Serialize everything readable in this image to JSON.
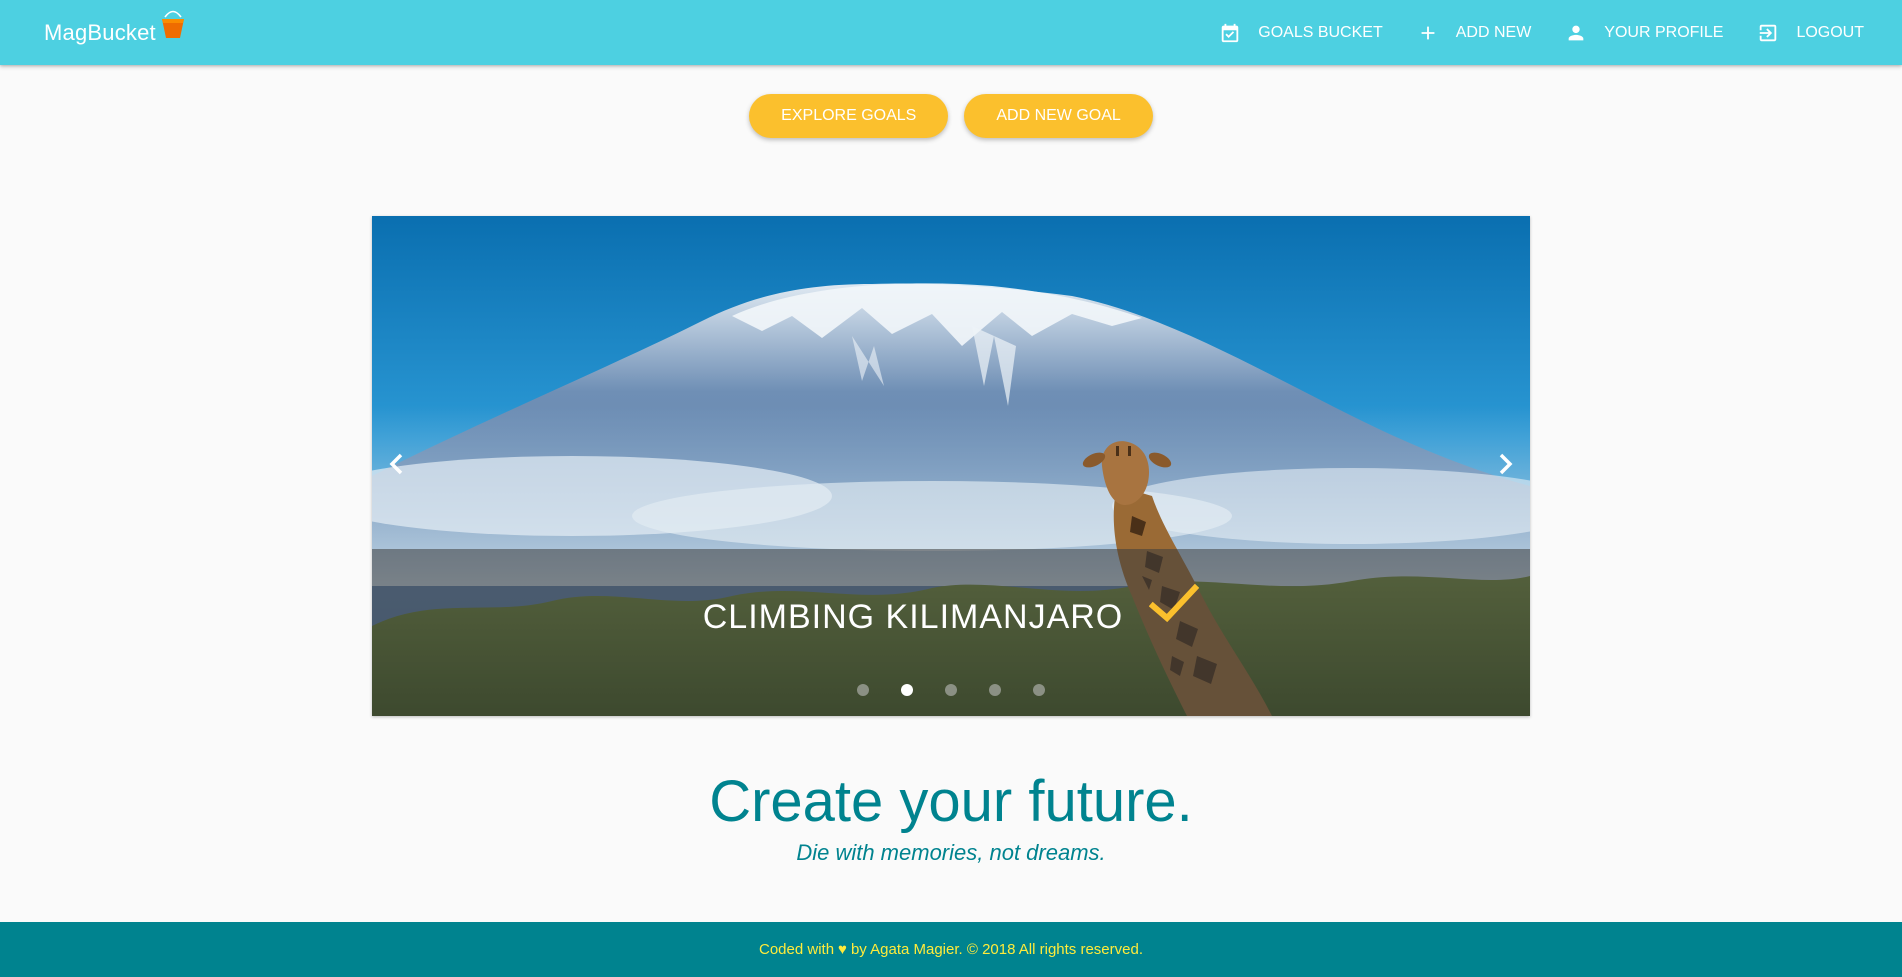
{
  "navbar": {
    "brand": "MagBucket",
    "items": [
      {
        "label": "GOALS BUCKET",
        "icon": "calendar-check-icon"
      },
      {
        "label": "ADD NEW",
        "icon": "plus-icon"
      },
      {
        "label": "YOUR PROFILE",
        "icon": "person-icon"
      },
      {
        "label": "LOGOUT",
        "icon": "exit-icon"
      }
    ]
  },
  "buttons": {
    "explore": "EXPLORE GOALS",
    "add_goal": "ADD NEW GOAL"
  },
  "carousel": {
    "caption": "CLIMBING KILIMANJARO",
    "caption_icon": "check-icon",
    "slide_count": 5,
    "active_slide": 2
  },
  "hero": {
    "headline": "Create your future.",
    "subline": "Die with memories, not dreams."
  },
  "footer": {
    "prefix": "Coded with",
    "heart": "♥",
    "suffix": "by Agata Magier. © 2018 All rights reserved."
  },
  "colors": {
    "navbar": "#4dd0e1",
    "accent": "#fbc02d",
    "teal": "#00838f",
    "footer_text": "#ffeb3b"
  }
}
